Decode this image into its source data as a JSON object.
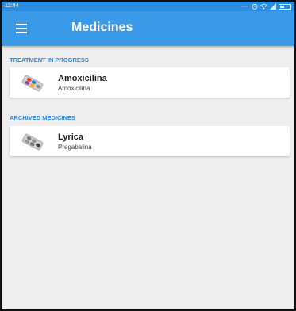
{
  "status_bar": {
    "time": "12:44",
    "dots": "..."
  },
  "app_bar": {
    "title": "Medicines"
  },
  "sections": [
    {
      "header": "TREATMENT IN PROGRESS",
      "items": [
        {
          "name": "Amoxicilina",
          "subtitle": "Amoxicilina",
          "icon": "colored-pills-icon"
        }
      ]
    },
    {
      "header": "ARCHIVED MEDICINES",
      "items": [
        {
          "name": "Lyrica",
          "subtitle": "Pregabalina",
          "icon": "grey-pills-icon"
        }
      ]
    }
  ],
  "colors": {
    "status_bar": "#2b8ddf",
    "app_bar": "#3a9ae8",
    "section_header": "#2f86d4",
    "background": "#eeeeee"
  }
}
